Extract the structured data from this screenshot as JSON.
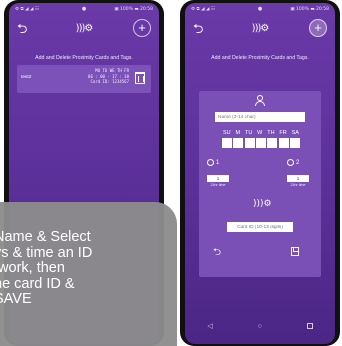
{
  "left_phone": {
    "status": {
      "left": "⚙ ⧉ ◢ ◢ ☷",
      "center": "●",
      "right": "▣ 100% ▬ 20:58"
    },
    "logo": ")))⚙",
    "add_symbol": "+",
    "back_symbol": "⮌",
    "subtitle": "Add and Delete Proximity Cards and Tags.",
    "entry": {
      "name": "test2",
      "days": "MO TU WE TH FR",
      "times": "06 : 00 - 17 : 30",
      "card": "Card ID: 1234567"
    }
  },
  "right_phone": {
    "status": {
      "left": "⚙ ⧉ ◢ ◢ ☷",
      "center": "●",
      "right": "▣ 100% ▬ 20:58"
    },
    "logo": ")))⚙",
    "add_symbol": "+",
    "back_symbol": "⮌",
    "subtitle": "Add and Delete Proximity Cards and Tags.",
    "form": {
      "name_placeholder": "Name (3-14 char)",
      "days": [
        "SU",
        "M",
        "TU",
        "W",
        "TH",
        "FR",
        "SA"
      ],
      "timer1": {
        "label": "1",
        "value": "1",
        "caption": "24hr time"
      },
      "timer2": {
        "label": "2",
        "value": "1",
        "caption": "24hr time"
      },
      "card_placeholder": "Card ID (10-13 digits)"
    },
    "nav": {
      "back": "◁",
      "home": "○"
    }
  },
  "tooltip": {
    "text": "Name & Select\nys & time an ID\n work, then\nhe card ID &\nSAVE"
  }
}
